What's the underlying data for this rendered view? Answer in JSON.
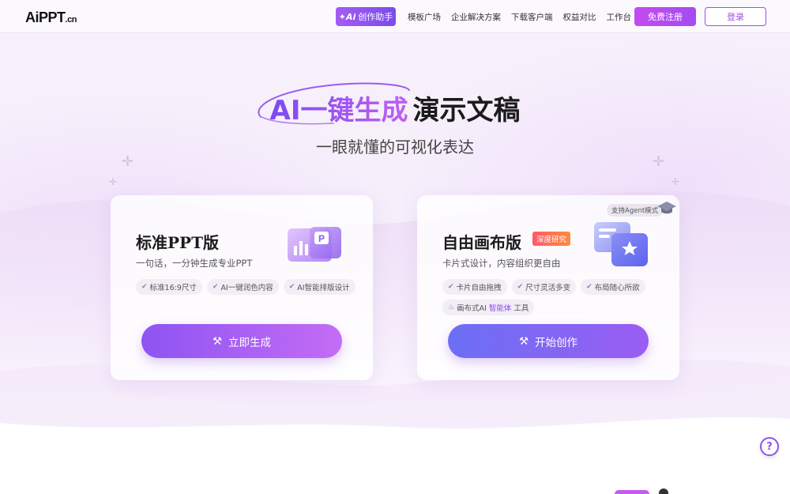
{
  "header": {
    "logo": "AiPPT",
    "logo_suffix": ".cn",
    "ai_helper_icon": "ai-sparkle-icon",
    "ai_helper_label": "创作助手",
    "nav": [
      "模板广场",
      "企业解决方案",
      "下载客户端",
      "权益对比",
      "工作台"
    ],
    "register_label": "免费注册",
    "login_label": "登录"
  },
  "hero": {
    "title_highlight": "AI一键生成",
    "title_rest": "演示文稿",
    "subtitle": "一眼就懂的可视化表达"
  },
  "cards": {
    "standard": {
      "title": "标准PPT版",
      "desc": "一句话，一分钟生成专业PPT",
      "tags": [
        "标准16:9尺寸",
        "AI一键润色内容",
        "AI智能排版设计"
      ],
      "cta": "立即生成",
      "illustration": "ppt-chart-icon"
    },
    "canvas": {
      "title": "自由画布版",
      "badge": "深度研究",
      "agent_badge": "支持Agent模式",
      "desc": "卡片式设计，内容组织更自由",
      "tags": [
        "卡片自由拖拽",
        "尺寸灵活多变",
        "布局随心所欲"
      ],
      "tool_tag_prefix": "画布式AI",
      "tool_tag_highlight": "智能体",
      "tool_tag_suffix": "工具",
      "cta": "开始创作",
      "illustration": "star-cards-icon"
    }
  },
  "help_label": "?",
  "colors": {
    "primary": "#8c46ee",
    "register": "#c34bf0",
    "badge": "#ff5a6a"
  }
}
